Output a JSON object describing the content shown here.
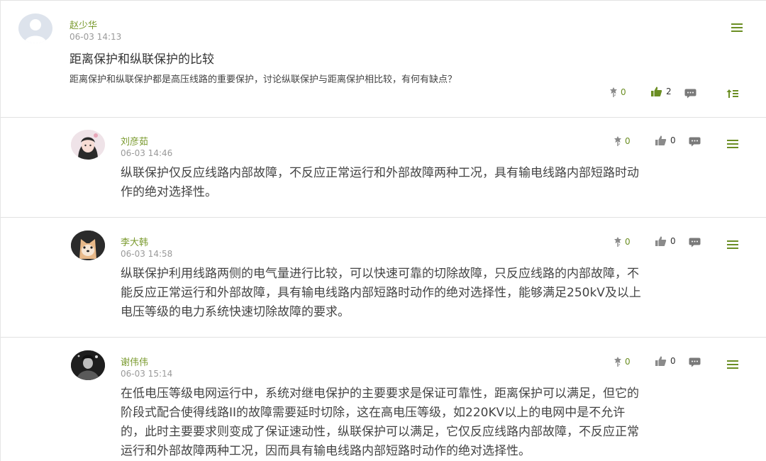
{
  "post": {
    "author": "赵少华",
    "time": "06-03 14:13",
    "title": "距离保护和纵联保护的比较",
    "description": "距离保护和纵联保护都是高压线路的重要保护，讨论纵联保护与距离保护相比较，有何有缺点？",
    "flower_count": "0",
    "like_count": "2"
  },
  "replies": [
    {
      "author": "刘彦茹",
      "time": "06-03 14:46",
      "lines": [
        "纵联保护仅反应线路内部故障，不反应正常运行和外部故障两种工况，具有输电线路内部短路时动",
        "作的绝对选择性。"
      ],
      "flower_count": "0",
      "like_count": "0"
    },
    {
      "author": "李大韩",
      "time": "06-03 14:58",
      "lines": [
        "纵联保护利用线路两侧的电气量进行比较，可以快速可靠的切除故障，只反应线路的内部故障，不",
        "能反应正常运行和外部故障，具有输电线路内部短路时动作的绝对选择性，能够满足250kV及以上",
        "电压等级的电力系统快速切除故障的要求。"
      ],
      "flower_count": "0",
      "like_count": "0"
    },
    {
      "author": "谢伟伟",
      "time": "06-03 15:14",
      "lines": [
        "在低电压等级电网运行中，系统对继电保护的主要要求是保证可靠性，距离保护可以满足，但它的",
        "阶段式配合使得线路II的故障需要延时切除，这在高电压等级，如220KV以上的电网中是不允许",
        "的，此时主要要求则变成了保证速动性，纵联保护可以满足，它仅反应线路内部故障，不反应正常",
        "运行和外部故障两种工况，因而具有输电线路内部短路时动作的绝对选择性。"
      ],
      "flower_count": "0",
      "like_count": "0"
    }
  ],
  "colors": {
    "accent": "#6b8e23",
    "author": "#7a9a2e",
    "icon_gray": "#8a8a8a"
  },
  "icons": [
    "flower-icon",
    "thumbs-up-icon",
    "comment-icon",
    "menu-icon",
    "sort-icon"
  ]
}
